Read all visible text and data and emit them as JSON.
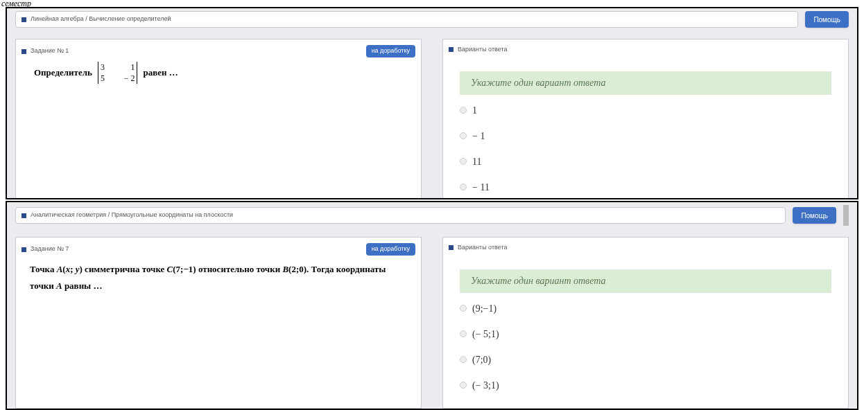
{
  "heading": "семестр",
  "screens": [
    {
      "kind": "determinant",
      "breadcrumb": "Линейная алгебра / Вычисление определителей",
      "help_button": "Помощь",
      "task_title": "Задание № 1",
      "rework_button": "на доработку",
      "question_before": "Определитель",
      "matrix": [
        [
          "3",
          "1"
        ],
        [
          "5",
          "− 2"
        ]
      ],
      "question_after": "равен …",
      "answers_title": "Варианты ответа",
      "instruction": "Укажите один вариант ответа",
      "options": [
        {
          "label": "1",
          "selected": false
        },
        {
          "label": "− 1",
          "selected": false
        },
        {
          "label": "11",
          "selected": false
        },
        {
          "label": "− 11",
          "selected": false
        }
      ]
    },
    {
      "kind": "text",
      "breadcrumb": "Аналитическая геометрия / Прямоугольные координаты на плоскости",
      "help_button": "Помощь",
      "task_title": "Задание № 7",
      "rework_button": "на доработку",
      "question": "Точка *A*(*x*; *y*) симметрична точке *C*(7;−1) относительно точки *B*(2;0). Тогда координаты точки *A* равны …",
      "answers_title": "Варианты ответа",
      "instruction": "Укажите один вариант ответа",
      "options": [
        {
          "label": "(9;−1)",
          "selected": false
        },
        {
          "label": "(− 5;1)",
          "selected": false
        },
        {
          "label": "(7;0)",
          "selected": false
        },
        {
          "label": "(− 3;1)",
          "selected": false
        }
      ]
    }
  ]
}
